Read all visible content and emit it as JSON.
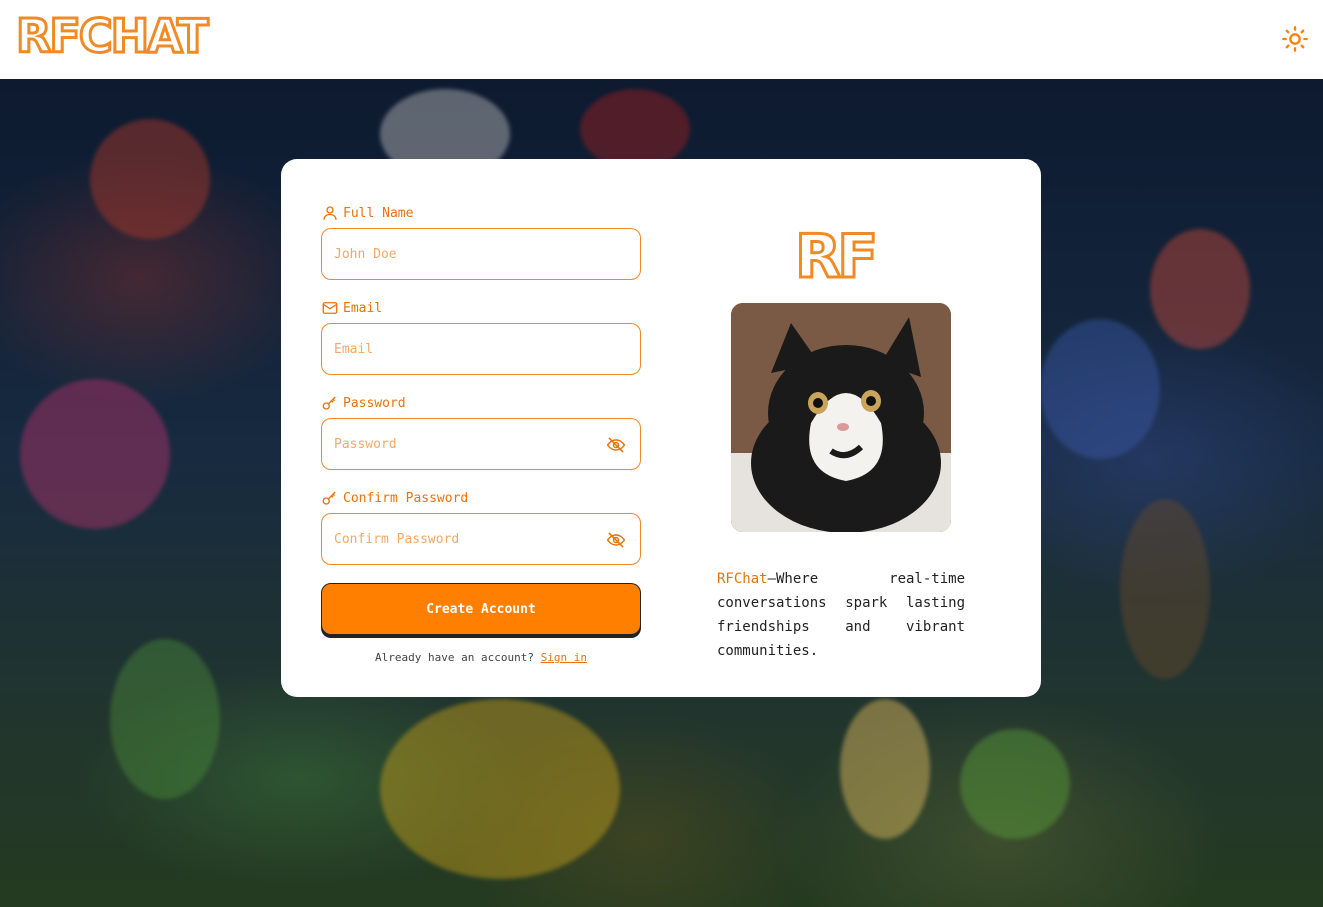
{
  "header": {
    "logo_text": "RFCHAT",
    "theme_toggle_icon": "sun-icon"
  },
  "form": {
    "full_name": {
      "label": "Full Name",
      "placeholder": "John Doe",
      "icon": "user-icon"
    },
    "email": {
      "label": "Email",
      "placeholder": "Email",
      "icon": "mail-icon"
    },
    "password": {
      "label": "Password",
      "placeholder": "Password",
      "icon": "key-icon",
      "toggle_icon": "eye-off-icon"
    },
    "confirm_password": {
      "label": "Confirm Password",
      "placeholder": "Confirm Password",
      "icon": "key-icon",
      "toggle_icon": "eye-off-icon"
    },
    "submit_label": "Create Account",
    "signin_prompt": "Already have an account?",
    "signin_link": "Sign in"
  },
  "side": {
    "logo_text": "RF",
    "brand": "RFChat",
    "tagline": "—Where real-time conversations spark lasting friendships and vibrant communities."
  },
  "colors": {
    "accent": "#ff7f00",
    "accent_text": "#e8730a",
    "card_bg": "#ffffff"
  }
}
